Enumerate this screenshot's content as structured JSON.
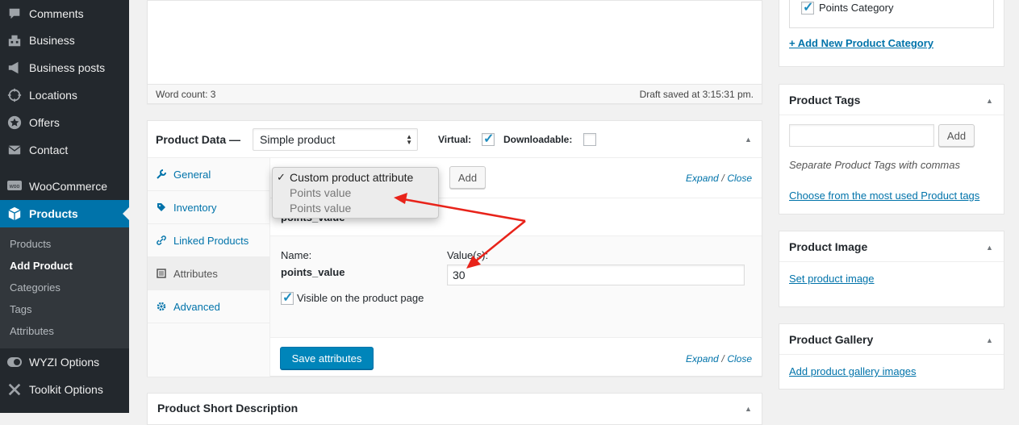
{
  "sidebar": {
    "menu": [
      {
        "label": "Comments",
        "icon": "comments-icon"
      },
      {
        "label": "Business",
        "icon": "building-icon"
      },
      {
        "label": "Business posts",
        "icon": "megaphone-icon"
      },
      {
        "label": "Locations",
        "icon": "location-icon"
      },
      {
        "label": "Offers",
        "icon": "star-icon"
      },
      {
        "label": "Contact",
        "icon": "email-icon"
      },
      {
        "label": "WooCommerce",
        "icon": "woocommerce-icon"
      },
      {
        "label": "Products",
        "icon": "products-icon"
      },
      {
        "label": "WYZI Options",
        "icon": "toggle-icon"
      },
      {
        "label": "Toolkit Options",
        "icon": "tools-icon"
      }
    ],
    "submenu": [
      "Products",
      "Add Product",
      "Categories",
      "Tags",
      "Attributes"
    ]
  },
  "editor": {
    "word_count": "Word count: 3",
    "draft_saved": "Draft saved at 3:15:31 pm."
  },
  "product_data": {
    "title": "Product Data —",
    "type_select": "Simple product",
    "virtual_label": "Virtual:",
    "virtual_checked": true,
    "downloadable_label": "Downloadable:",
    "downloadable_checked": false,
    "tabs": [
      {
        "label": "General",
        "icon": "wrench-icon"
      },
      {
        "label": "Inventory",
        "icon": "tag-icon"
      },
      {
        "label": "Linked Products",
        "icon": "link-icon"
      },
      {
        "label": "Attributes",
        "icon": "list-icon"
      },
      {
        "label": "Advanced",
        "icon": "gear-icon"
      }
    ],
    "active_tab": "Attributes",
    "add_button": "Add",
    "expand_label": "Expand",
    "slash": "/",
    "close_label": "Close",
    "attribute_header": "points_value",
    "name_label": "Name:",
    "attribute_name": "points_value",
    "values_label": "Value(s):",
    "value": "30",
    "visible_label": "Visible on the product page",
    "visible_checked": true,
    "save_button": "Save attributes",
    "dropdown": {
      "check": "✓",
      "options": [
        "Custom product attribute",
        "Points value",
        "Points value"
      ]
    }
  },
  "short_description": {
    "title": "Product Short Description"
  },
  "categories": {
    "item": "Points Category",
    "item_checked": true,
    "add_link": "+ Add New Product Category"
  },
  "tags": {
    "title": "Product Tags",
    "add_button": "Add",
    "hint": "Separate Product Tags with commas",
    "choose_link": "Choose from the most used Product tags"
  },
  "image": {
    "title": "Product Image",
    "link": "Set product image"
  },
  "gallery": {
    "title": "Product Gallery",
    "link": "Add product gallery images"
  },
  "colors": {
    "accent": "#0073aa",
    "sidebar": "#23282d",
    "arrow": "#e8231a"
  }
}
